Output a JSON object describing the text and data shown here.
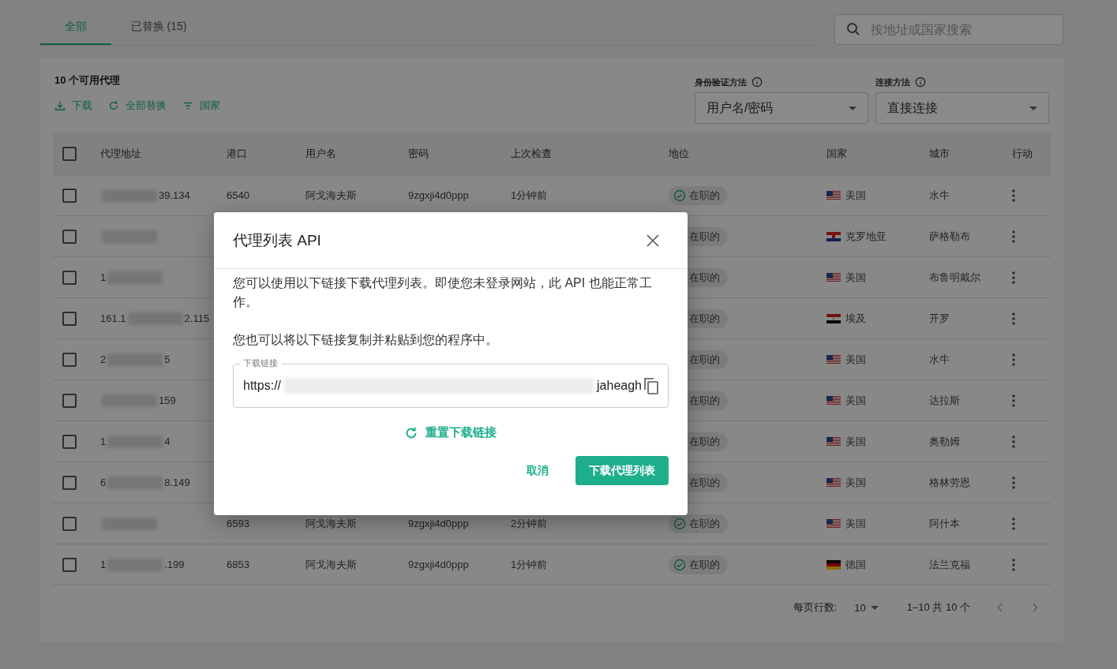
{
  "tabs": [
    {
      "label": "全部",
      "selected": true
    },
    {
      "label": "已替换 (15)",
      "selected": false
    }
  ],
  "search": {
    "placeholder": "按地址或国家搜索"
  },
  "card": {
    "title": "10 个可用代理",
    "actions": [
      {
        "kind": "download",
        "label": "下载"
      },
      {
        "kind": "refresh",
        "label": "全部替换"
      },
      {
        "kind": "filter",
        "label": "国家"
      }
    ],
    "selects": [
      {
        "label": "身份验证方法",
        "value": "用户名/密码"
      },
      {
        "label": "连接方法",
        "value": "直接连接"
      }
    ]
  },
  "table": {
    "all_checked": false,
    "columns": [
      "代理地址",
      "港口",
      "用户名",
      "密码",
      "上次检查",
      "地位",
      "国家",
      "城市",
      "行动"
    ],
    "rows": [
      {
        "checked": false,
        "ip_start": "",
        "ip_end": "39.134",
        "port": "6540",
        "user": "阿戈海夫斯",
        "password": "9zgxji4d0ppp",
        "checked_at": "1分钟前",
        "status": "在职的",
        "status_icon": true,
        "flag": {
          "kind": "us"
        },
        "country": "美国",
        "city": "水牛"
      },
      {
        "checked": false,
        "ip_start": "",
        "ip_end": "",
        "status": "在职的",
        "flag": {
          "kind": "hr"
        },
        "country": "克罗地亚",
        "city": "萨格勒布"
      },
      {
        "checked": false,
        "ip_start": "1",
        "ip_end": "",
        "status": "在职的",
        "flag": {
          "kind": "us"
        },
        "country": "美国",
        "city": "布鲁明戴尔"
      },
      {
        "checked": false,
        "ip_start": "161.1",
        "ip_end": "2.115",
        "status": "在职的",
        "flag": {
          "kind": "eg"
        },
        "country": "埃及",
        "city": "开罗"
      },
      {
        "checked": false,
        "ip_start": "2",
        "ip_end": "5",
        "status": "在职的",
        "flag": {
          "kind": "us"
        },
        "country": "美国",
        "city": "水牛"
      },
      {
        "checked": false,
        "ip_start": "",
        "ip_end": "159",
        "status": "在职的",
        "flag": {
          "kind": "us"
        },
        "country": "美国",
        "city": "达拉斯"
      },
      {
        "checked": false,
        "ip_start": "1",
        "ip_end": "4",
        "status": "在职的",
        "flag": {
          "kind": "us"
        },
        "country": "美国",
        "city": "奥勒姆"
      },
      {
        "checked": false,
        "ip_start": "6",
        "ip_end": "8.149",
        "status": "在职的",
        "flag": {
          "kind": "us"
        },
        "country": "美国",
        "city": "格林劳恩"
      },
      {
        "checked": false,
        "ip_start": "",
        "ip_end": "",
        "port": "6593",
        "user": "阿戈海夫斯",
        "password": "9zgxji4d0ppp",
        "checked_at": "2分钟前",
        "status": "在职的",
        "status_icon": true,
        "flag": {
          "kind": "us"
        },
        "country": "美国",
        "city": "阿什本"
      },
      {
        "checked": false,
        "ip_start": "1",
        "ip_end": ".199",
        "port": "6853",
        "user": "阿戈海夫斯",
        "password": "9zgxji4d0ppp",
        "checked_at": "1分钟前",
        "status": "在职的",
        "status_icon": true,
        "flag": {
          "kind": "de"
        },
        "country": "德国",
        "city": "法兰克福"
      }
    ]
  },
  "pagination": {
    "rows_label": "每页行数:",
    "rows_value": "10",
    "range": "1–10 共 10 个"
  },
  "dialog": {
    "title": "代理列表 API",
    "paragraphs": [
      "您可以使用以下链接下载代理列表。即使您未登录网站，此 API 也能正常工作。",
      "您也可以将以下链接复制并粘贴到您的程序中。"
    ],
    "field_label": "下载链接",
    "url_start": "https://",
    "url_end": "jaheagh",
    "reset": "重置下载链接",
    "cancel": "取消",
    "confirm": "下载代理列表"
  }
}
